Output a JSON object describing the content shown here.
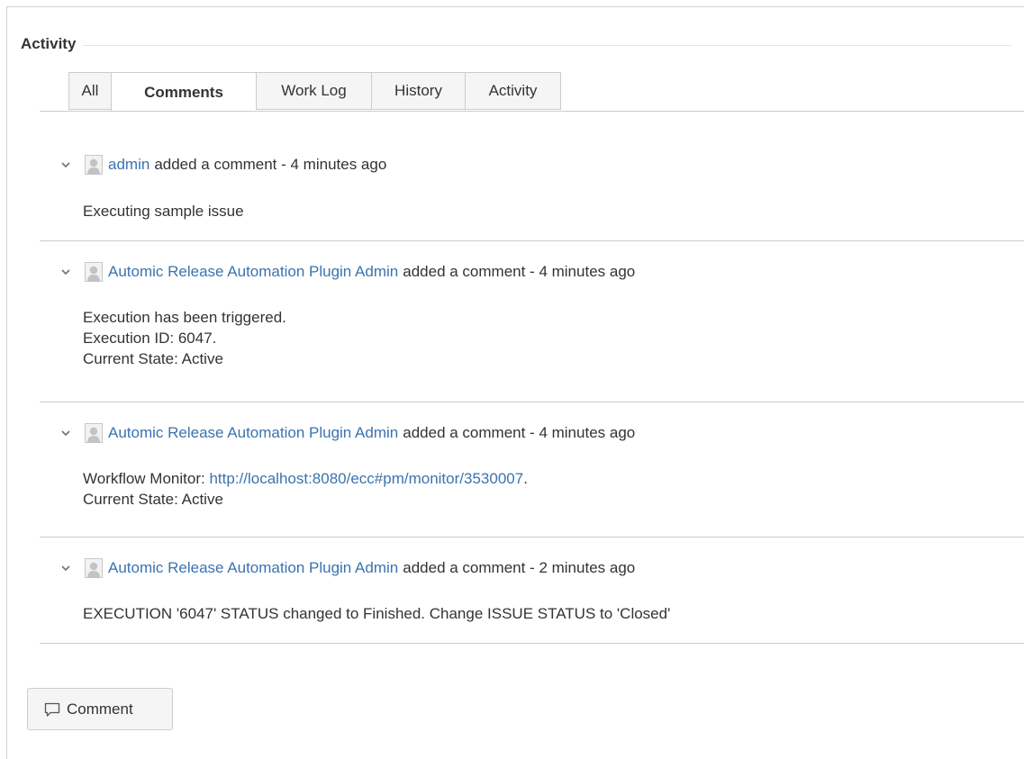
{
  "activity": {
    "title": "Activity"
  },
  "tabs": [
    {
      "label": "All"
    },
    {
      "label": "Comments"
    },
    {
      "label": "Work Log"
    },
    {
      "label": "History"
    },
    {
      "label": "Activity"
    }
  ],
  "comments": [
    {
      "author": "admin",
      "action": "added a comment - 4 minutes ago",
      "lines": [
        "Executing sample issue"
      ]
    },
    {
      "author": "Automic Release Automation Plugin Admin",
      "action": "added a comment - 4 minutes ago",
      "lines": [
        "Execution has been triggered.",
        "Execution ID: 6047.",
        "Current State: Active"
      ]
    },
    {
      "author": "Automic Release Automation Plugin Admin",
      "action": "added a comment - 4 minutes ago",
      "link_prefix": "Workflow Monitor: ",
      "link": "http://localhost:8080/ecc#pm/monitor/3530007",
      "link_suffix": ".",
      "lines": [
        "Current State: Active"
      ]
    },
    {
      "author": "Automic Release Automation Plugin Admin",
      "action": "added a comment - 2 minutes ago",
      "lines": [
        "EXECUTION '6047' STATUS changed to Finished. Change ISSUE STATUS to 'Closed'"
      ]
    }
  ],
  "footer": {
    "comment_button_label": "Comment"
  },
  "icons": {
    "chevron": "chevron-down-icon",
    "avatar": "default-avatar-icon",
    "comment": "speech-bubble-icon"
  },
  "colors": {
    "link": "#3b73af",
    "text": "#333333",
    "border": "#cccccc"
  }
}
